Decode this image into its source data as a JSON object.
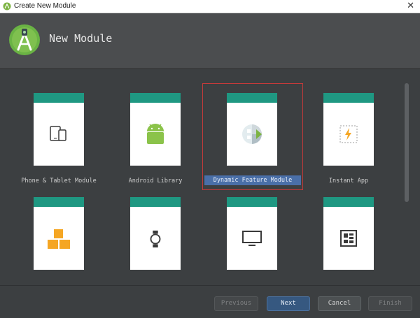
{
  "window": {
    "title": "Create New Module",
    "close_glyph": "✕"
  },
  "header": {
    "title": "New Module",
    "logo_icon": "android-studio-logo"
  },
  "modules": [
    {
      "label": "Phone & Tablet Module",
      "icon": "phone-tablet-icon",
      "selected": false
    },
    {
      "label": "Android Library",
      "icon": "android-icon",
      "selected": false
    },
    {
      "label": "Dynamic Feature Module",
      "icon": "dynamic-feature-icon",
      "selected": true
    },
    {
      "label": "Instant App",
      "icon": "instant-app-icon",
      "selected": false
    },
    {
      "label": "",
      "icon": "modules-blocks-icon",
      "selected": false
    },
    {
      "label": "",
      "icon": "watch-icon",
      "selected": false
    },
    {
      "label": "",
      "icon": "tv-icon",
      "selected": false
    },
    {
      "label": "",
      "icon": "things-board-icon",
      "selected": false
    }
  ],
  "buttons": {
    "previous": "Previous",
    "next": "Next",
    "cancel": "Cancel",
    "finish": "Finish"
  },
  "colors": {
    "card_band": "#1f9882",
    "selection_label_bg": "#4a6fa8",
    "selection_border": "#c53a3a",
    "primary_button": "#365880"
  }
}
